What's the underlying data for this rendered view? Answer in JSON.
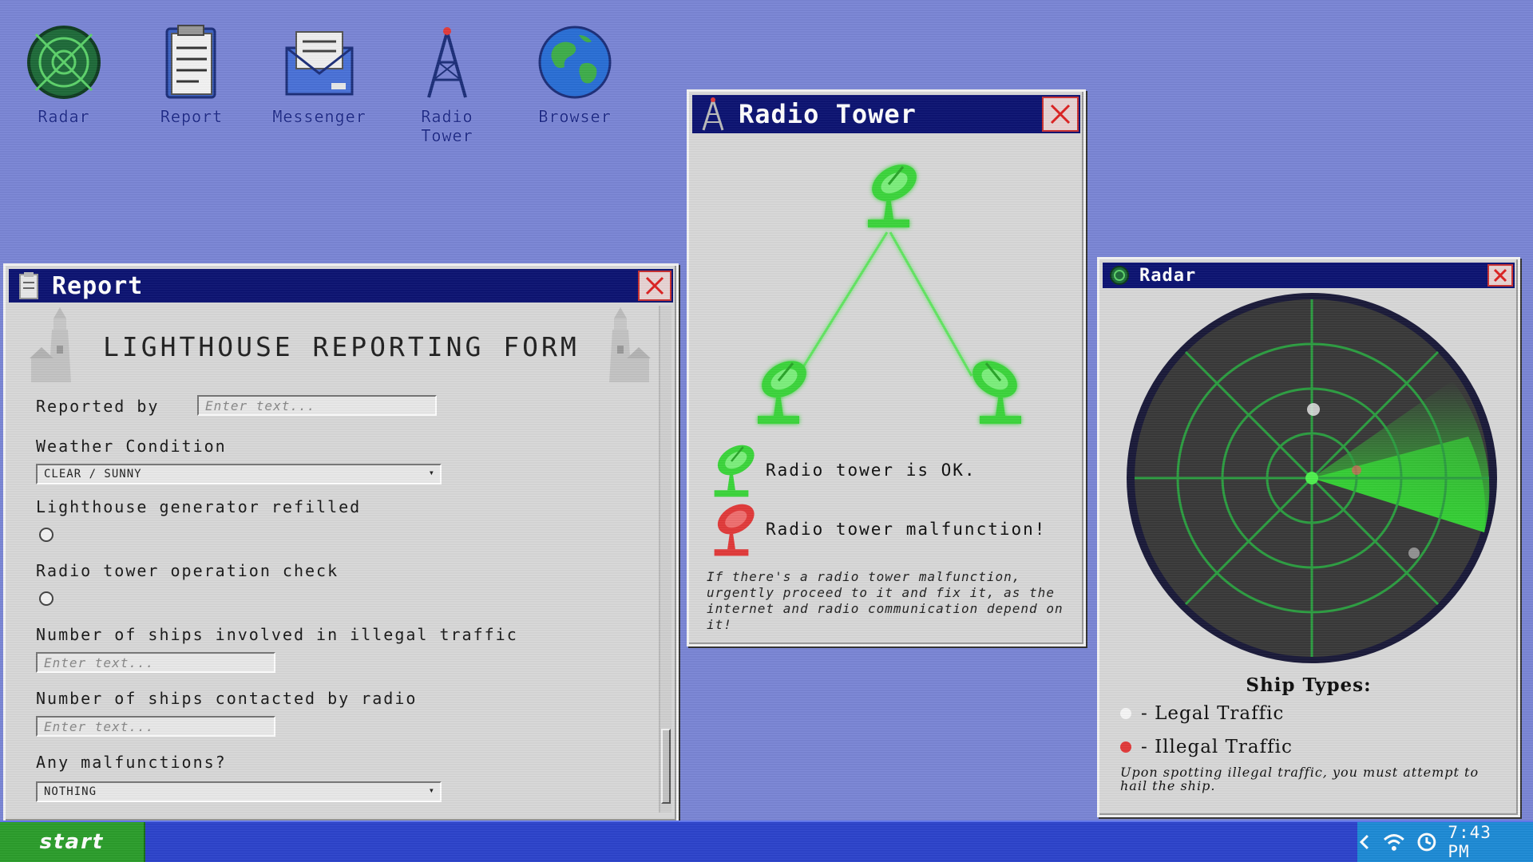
{
  "desktop": {
    "icons": [
      {
        "label": "Radar"
      },
      {
        "label": "Report"
      },
      {
        "label": "Messenger"
      },
      {
        "label": "Radio\nTower"
      },
      {
        "label": "Browser"
      }
    ]
  },
  "report_window": {
    "title": "Report",
    "form_title": "LIGHTHOUSE REPORTING FORM",
    "fields": {
      "reported_by": {
        "label": "Reported by",
        "placeholder": "Enter text..."
      },
      "weather": {
        "label": "Weather Condition",
        "value": "CLEAR / SUNNY"
      },
      "generator": {
        "label": "Lighthouse generator refilled"
      },
      "tower_check": {
        "label": "Radio tower operation check"
      },
      "illegal_ships": {
        "label": "Number of ships involved in illegal traffic",
        "placeholder": "Enter text..."
      },
      "contacted_ships": {
        "label": "Number of ships contacted by radio",
        "placeholder": "Enter text..."
      },
      "malfunctions": {
        "label": "Any malfunctions?",
        "value": "NOTHING"
      }
    }
  },
  "radio_tower_window": {
    "title": "Radio Tower",
    "legend_ok": "Radio tower is OK.",
    "legend_bad": "Radio tower malfunction!",
    "note": "If there's a radio tower malfunction, urgently proceed to it and fix it, as the internet and radio communication depend on it!"
  },
  "radar_window": {
    "title": "Radar",
    "ship_types_title": "Ship Types:",
    "legal": "- Legal Traffic",
    "illegal": "- Illegal Traffic",
    "note": "Upon spotting illegal traffic, you must attempt to hail the ship."
  },
  "taskbar": {
    "start_label": "start",
    "clock": "7:43 PM"
  },
  "colors": {
    "desktop": "#7b86d6",
    "title_bar": "#0d1473",
    "radar_green": "#3fdc3f",
    "illegal_red": "#e23b3b",
    "start_green": "#2c9e2c",
    "taskbar_blue": "#2d44cc"
  }
}
